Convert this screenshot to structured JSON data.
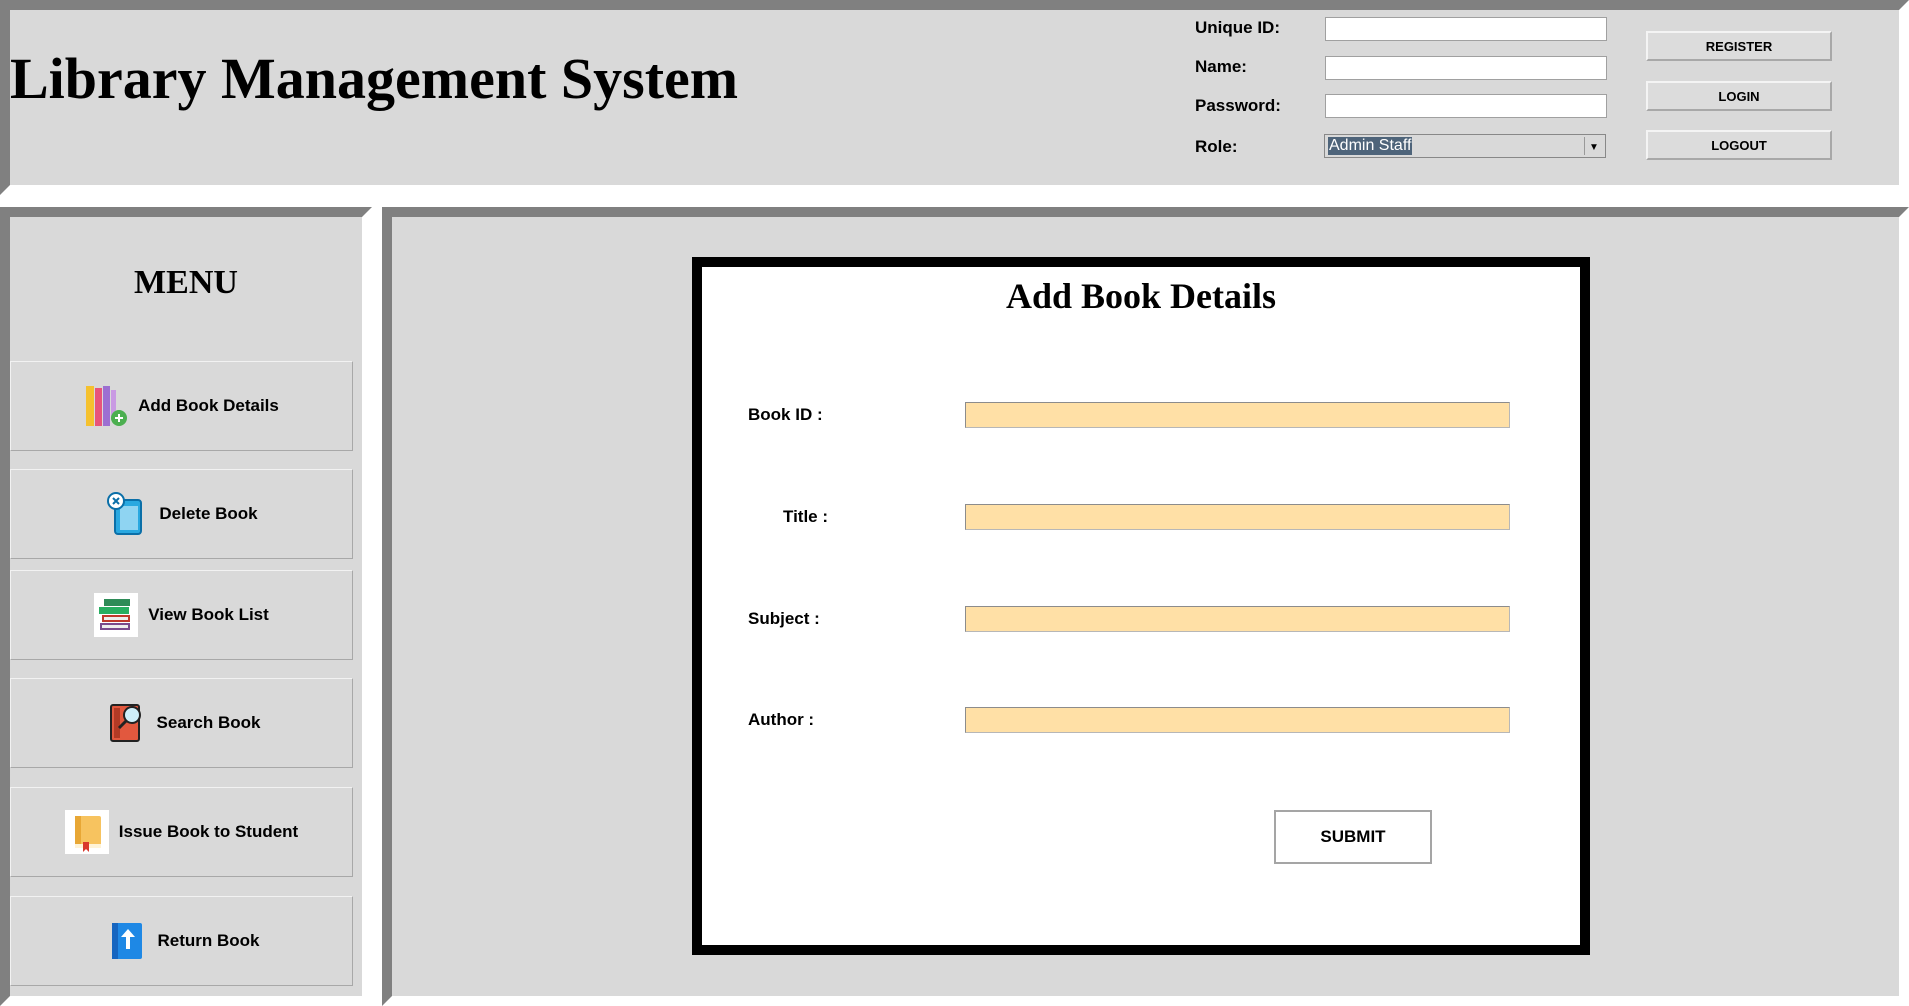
{
  "header": {
    "title": "Library Management System",
    "fields": {
      "unique_id": {
        "label": "Unique ID:",
        "value": ""
      },
      "name": {
        "label": "Name:",
        "value": ""
      },
      "password": {
        "label": "Password:",
        "value": ""
      },
      "role": {
        "label": "Role:",
        "value": "Admin Staff"
      }
    },
    "buttons": {
      "register": "REGISTER",
      "login": "LOGIN",
      "logout": "LOGOUT"
    }
  },
  "sidebar": {
    "title": "MENU",
    "items": [
      {
        "label": "Add Book Details",
        "icon": "add-books-icon"
      },
      {
        "label": "Delete Book",
        "icon": "delete-book-icon"
      },
      {
        "label": "View Book List",
        "icon": "book-stack-icon"
      },
      {
        "label": "Search Book",
        "icon": "search-book-icon"
      },
      {
        "label": "Issue Book to Student",
        "icon": "issue-book-icon"
      },
      {
        "label": "Return Book",
        "icon": "return-book-icon"
      }
    ]
  },
  "form": {
    "title": "Add Book Details",
    "fields": [
      {
        "label": "Book ID :",
        "value": ""
      },
      {
        "label": "Title :",
        "value": ""
      },
      {
        "label": "Subject :",
        "value": ""
      },
      {
        "label": "Author :",
        "value": ""
      }
    ],
    "submit_label": "SUBMIT"
  },
  "colors": {
    "panel_bg": "#d9d9d9",
    "bevel_dark": "#808080",
    "input_fill": "#ffe0a6",
    "selection": "#4e647a"
  }
}
